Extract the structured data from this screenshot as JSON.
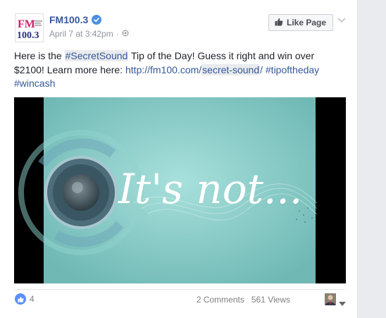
{
  "post": {
    "page_name": "FM100.3",
    "timestamp": "April 7 at 3:42pm",
    "separator": "·",
    "audience_icon": "public-globe-icon",
    "like_page_label": "Like Page",
    "logo_text_top": "FM",
    "logo_text_bottom": "100.3",
    "text_parts": {
      "p1": "Here is the ",
      "hashtag_secret": "#SecretSound",
      "p2": " Tip of the Day! Guess it right and win over $2100! Learn more here: ",
      "url_a": "http://fm100.com/",
      "url_b": "secret-sound",
      "url_c": "/",
      "p3": " ",
      "hashtag_tip": "#tipoftheday",
      "hashtag_win": "#wincash"
    }
  },
  "video": {
    "overlay_text": "It's not...",
    "accent": "#8fd3cd"
  },
  "footer": {
    "like_count": "4",
    "comments": "2 Comments",
    "views": "561 Views"
  },
  "colors": {
    "link": "#365899",
    "brand_pink": "#d61f6d",
    "brand_blue": "#2b2f7b",
    "verified": "#4a90e2"
  }
}
